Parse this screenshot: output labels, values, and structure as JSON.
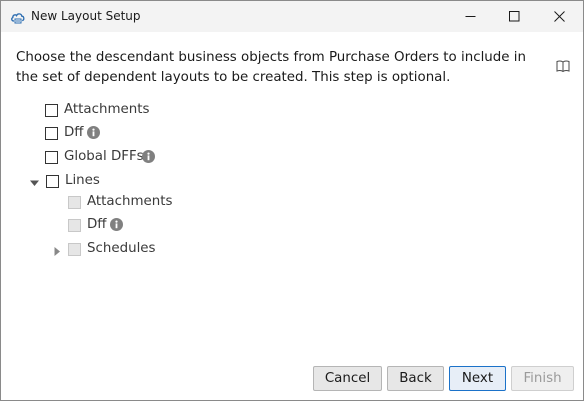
{
  "window": {
    "title": "New Layout Setup",
    "app_icon": "cloud-app-icon",
    "controls": [
      "minimize-icon",
      "maximize-icon",
      "close-icon"
    ]
  },
  "instructions": {
    "text": "Choose the descendant business objects from Purchase Orders to include in the set of dependent layouts to be created. This step is optional.",
    "help_icon": "book-icon"
  },
  "tree": {
    "nodes": [
      {
        "label": "Attachments",
        "checked": false,
        "enabled": true,
        "info": false
      },
      {
        "label": "Dff",
        "checked": false,
        "enabled": true,
        "info": true
      },
      {
        "label": "Global DFFs",
        "checked": false,
        "enabled": true,
        "info": true
      },
      {
        "label": "Lines",
        "checked": false,
        "enabled": true,
        "info": false,
        "expanded": true,
        "children": [
          {
            "label": "Attachments",
            "checked": false,
            "enabled": false,
            "info": false
          },
          {
            "label": "Dff",
            "checked": false,
            "enabled": false,
            "info": true
          },
          {
            "label": "Schedules",
            "checked": false,
            "enabled": false,
            "info": false,
            "expanded": false
          }
        ]
      }
    ]
  },
  "buttons": {
    "cancel": "Cancel",
    "back": "Back",
    "next": "Next",
    "finish": "Finish"
  },
  "colors": {
    "accent": "#1b72c9",
    "info_icon": "#808080",
    "titlebar": "#f3f3f3"
  }
}
